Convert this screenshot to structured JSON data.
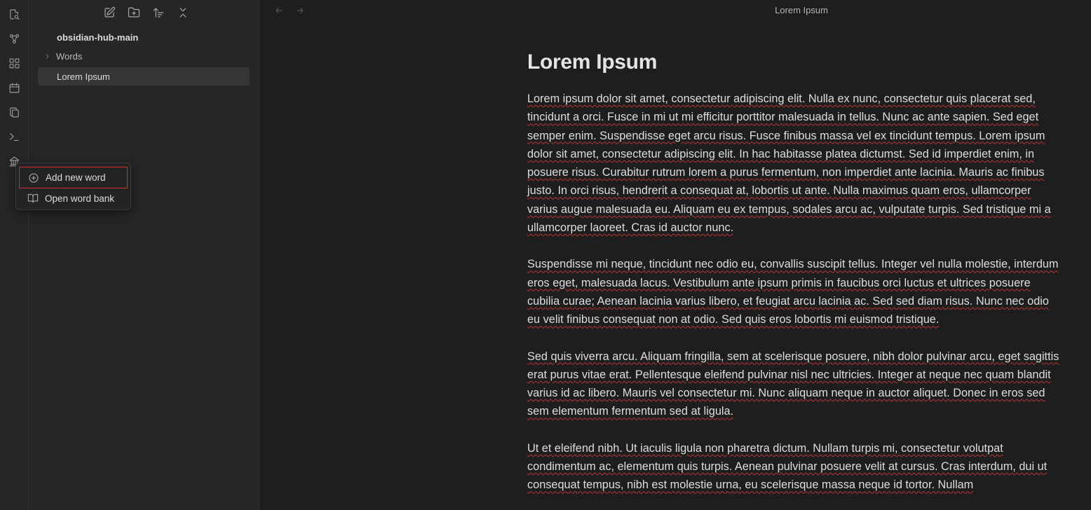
{
  "ribbon": {
    "icons": [
      "open-quick-switcher-icon",
      "graph-view-icon",
      "canvas-icon",
      "daily-note-icon",
      "templates-icon",
      "command-palette-icon",
      "word-bank-icon"
    ]
  },
  "sidebar": {
    "toolbar_icons": [
      "new-note-icon",
      "new-folder-icon",
      "sort-icon",
      "collapse-all-icon"
    ],
    "vault_name": "obsidian-hub-main",
    "tree": [
      {
        "label": "Words",
        "type": "folder"
      },
      {
        "label": "Lorem Ipsum",
        "type": "file",
        "active": true
      }
    ]
  },
  "context_menu": {
    "items": [
      {
        "label": "Add new word",
        "icon": "plus-circle-icon"
      },
      {
        "label": "Open word bank",
        "icon": "book-open-icon"
      }
    ]
  },
  "main": {
    "tab_title": "Lorem Ipsum",
    "heading": "Lorem Ipsum",
    "paragraphs": [
      "Lorem ipsum dolor sit amet, consectetur adipiscing elit. Nulla ex nunc, consectetur quis placerat sed, tincidunt a orci. Fusce in mi ut mi efficitur porttitor malesuada in tellus. Nunc ac ante sapien. Sed eget semper enim. Suspendisse eget arcu risus. Fusce finibus massa vel ex tincidunt tempus. Lorem ipsum dolor sit amet, consectetur adipiscing elit. In hac habitasse platea dictumst. Sed id imperdiet enim, in posuere risus. Curabitur rutrum lorem a purus fermentum, non imperdiet ante lacinia. Mauris ac finibus justo. In orci risus, hendrerit a consequat at, lobortis ut ante. Nulla maximus quam eros, ullamcorper varius augue malesuada eu. Aliquam eu ex tempus, sodales arcu ac, vulputate turpis. Sed tristique mi a ullamcorper laoreet. Cras id auctor nunc.",
      "Suspendisse mi neque, tincidunt nec odio eu, convallis suscipit tellus. Integer vel nulla molestie, interdum eros eget, malesuada lacus. Vestibulum ante ipsum primis in faucibus orci luctus et ultrices posuere cubilia curae; Aenean lacinia varius libero, et feugiat arcu lacinia ac. Sed sed diam risus. Nunc nec odio eu velit finibus consequat non at odio. Sed quis eros lobortis mi euismod tristique.",
      "Sed quis viverra arcu. Aliquam fringilla, sem at scelerisque posuere, nibh dolor pulvinar arcu, eget sagittis erat purus vitae erat. Pellentesque eleifend pulvinar nisl nec ultricies. Integer at neque nec quam blandit varius id ac libero. Mauris vel consectetur mi. Nunc aliquam neque in auctor aliquet. Donec in eros sed sem elementum fermentum sed at ligula.",
      "Ut et eleifend nibh. Ut iaculis ligula non pharetra dictum. Nullam turpis mi, consectetur volutpat condimentum ac, elementum quis turpis. Aenean pulvinar posuere velit at cursus. Cras interdum, dui ut consequat tempus, nibh est molestie urna, eu scelerisque massa neque id tortor. Nullam"
    ]
  },
  "colors": {
    "background": "#1e1e1e",
    "sidebar": "#262626",
    "active_item": "#363636",
    "highlight_border": "#d62b2b",
    "spellcheck": "#b33333"
  }
}
